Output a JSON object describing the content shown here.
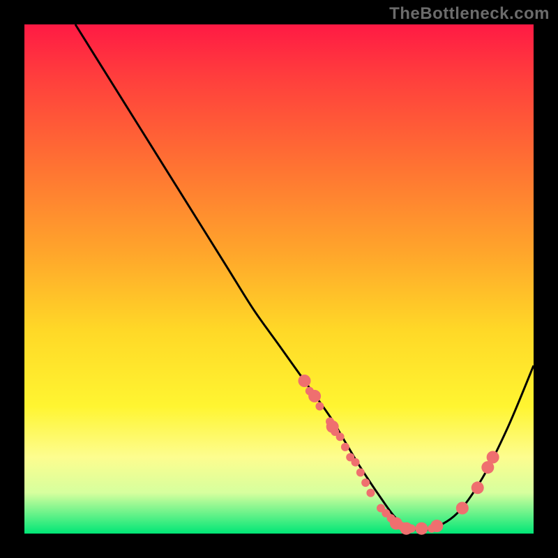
{
  "watermark": "TheBottleneck.com",
  "chart_data": {
    "type": "line",
    "title": "",
    "xlabel": "",
    "ylabel": "",
    "xlim": [
      0,
      100
    ],
    "ylim": [
      0,
      100
    ],
    "grid": false,
    "legend": false,
    "series": [
      {
        "name": "bottleneck-curve",
        "x": [
          10,
          15,
          20,
          25,
          30,
          35,
          40,
          45,
          50,
          55,
          60,
          63,
          66,
          70,
          73,
          76,
          80,
          85,
          90,
          95,
          100
        ],
        "y": [
          100,
          92,
          84,
          76,
          68,
          60,
          52,
          44,
          37,
          30,
          23,
          18,
          13,
          7,
          3,
          1,
          1,
          4,
          11,
          21,
          33
        ],
        "color": "#000000",
        "linewidth": 2
      }
    ],
    "markers": {
      "name": "highlighted-points",
      "color": "#ef6f6f",
      "radius_small": 6,
      "radius_large": 9,
      "points": [
        {
          "x": 55,
          "y": 30,
          "r": "large"
        },
        {
          "x": 56,
          "y": 28,
          "r": "small"
        },
        {
          "x": 57,
          "y": 27,
          "r": "large"
        },
        {
          "x": 58,
          "y": 25,
          "r": "small"
        },
        {
          "x": 60,
          "y": 22,
          "r": "small"
        },
        {
          "x": 60.5,
          "y": 21,
          "r": "large"
        },
        {
          "x": 61,
          "y": 20,
          "r": "small"
        },
        {
          "x": 62,
          "y": 19,
          "r": "small"
        },
        {
          "x": 63,
          "y": 17,
          "r": "small"
        },
        {
          "x": 64,
          "y": 15,
          "r": "small"
        },
        {
          "x": 65,
          "y": 14,
          "r": "small"
        },
        {
          "x": 66,
          "y": 12,
          "r": "small"
        },
        {
          "x": 67,
          "y": 10,
          "r": "small"
        },
        {
          "x": 68,
          "y": 8,
          "r": "small"
        },
        {
          "x": 70,
          "y": 5,
          "r": "small"
        },
        {
          "x": 71,
          "y": 4,
          "r": "small"
        },
        {
          "x": 72,
          "y": 3,
          "r": "small"
        },
        {
          "x": 73,
          "y": 2,
          "r": "large"
        },
        {
          "x": 74,
          "y": 1.5,
          "r": "small"
        },
        {
          "x": 75,
          "y": 1,
          "r": "large"
        },
        {
          "x": 76,
          "y": 1,
          "r": "small"
        },
        {
          "x": 78,
          "y": 1,
          "r": "large"
        },
        {
          "x": 80,
          "y": 1,
          "r": "small"
        },
        {
          "x": 81,
          "y": 1.5,
          "r": "large"
        },
        {
          "x": 86,
          "y": 5,
          "r": "large"
        },
        {
          "x": 89,
          "y": 9,
          "r": "large"
        },
        {
          "x": 91,
          "y": 13,
          "r": "large"
        },
        {
          "x": 92,
          "y": 15,
          "r": "large"
        }
      ]
    }
  }
}
